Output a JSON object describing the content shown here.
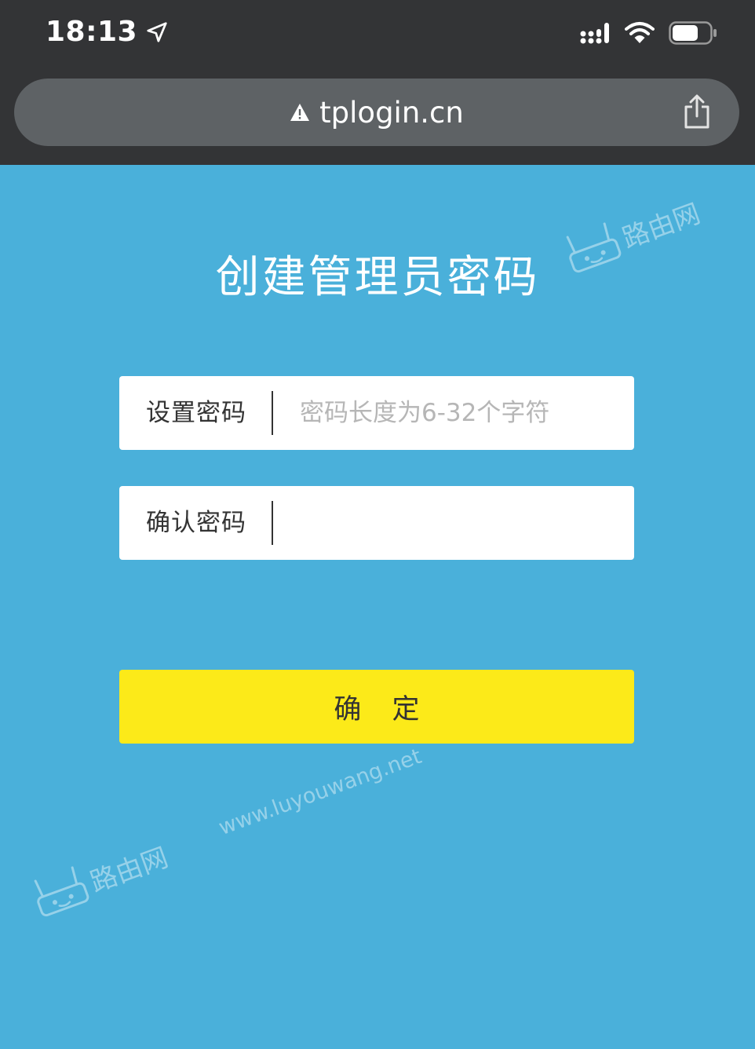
{
  "status_bar": {
    "time": "18:13"
  },
  "browser": {
    "url": "tplogin.cn"
  },
  "page": {
    "title": "创建管理员密码",
    "set_password": {
      "label": "设置密码",
      "placeholder": "密码长度为6-32个字符",
      "value": ""
    },
    "confirm_password": {
      "label": "确认密码",
      "value": ""
    },
    "confirm_button": "确 定"
  },
  "watermark": {
    "brand": "路由网",
    "url": "www.luyouwang.net"
  },
  "colors": {
    "background": "#4ab0da",
    "chrome": "#333436",
    "address_bar": "#5e6265",
    "button": "#fcea19"
  },
  "icons": [
    "location-arrow-icon",
    "signal-icon",
    "wifi-icon",
    "battery-icon",
    "warning-icon",
    "share-icon"
  ]
}
